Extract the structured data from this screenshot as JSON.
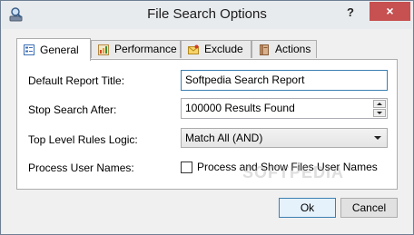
{
  "window": {
    "title": "File Search Options",
    "help_label": "?",
    "close_label": "×"
  },
  "tabs": [
    {
      "label": "General",
      "icon": "form-icon",
      "active": true
    },
    {
      "label": "Performance",
      "icon": "gauge-icon",
      "active": false
    },
    {
      "label": "Exclude",
      "icon": "envelope-icon",
      "active": false
    },
    {
      "label": "Actions",
      "icon": "book-icon",
      "active": false
    }
  ],
  "general": {
    "report_title_label": "Default Report Title:",
    "report_title_value": "Softpedia Search Report",
    "stop_search_label": "Stop Search After:",
    "stop_search_value": "100000 Results Found",
    "rules_logic_label": "Top Level Rules Logic:",
    "rules_logic_value": "Match All (AND)",
    "process_users_label": "Process User Names:",
    "process_users_checkbox_label": "Process and Show Files User Names",
    "process_users_checked": false
  },
  "watermark": "SOFTPEDIA",
  "buttons": {
    "ok_label": "Ok",
    "cancel_label": "Cancel"
  }
}
